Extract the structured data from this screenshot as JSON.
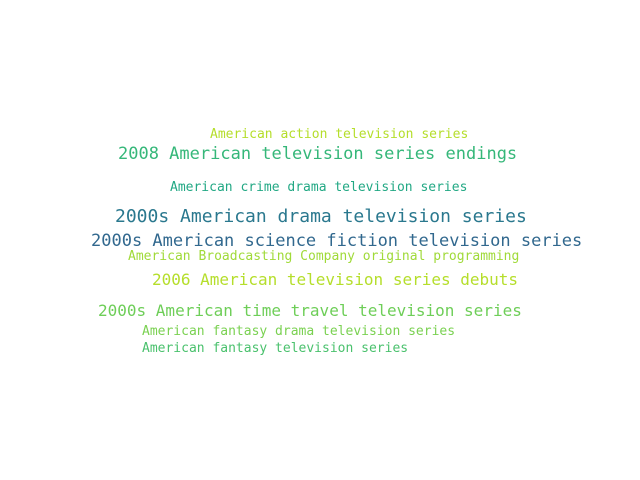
{
  "word_cloud": {
    "words": [
      {
        "text": "American action television series",
        "color": "#b5de2b"
      },
      {
        "text": "2008 American television series endings",
        "color": "#35b779"
      },
      {
        "text": "American crime drama television series",
        "color": "#22a884"
      },
      {
        "text": "2000s American drama television series",
        "color": "#2a788e"
      },
      {
        "text": "2000s American science fiction television series",
        "color": "#31688e"
      },
      {
        "text": "American Broadcasting Company original programming",
        "color": "#a0da39"
      },
      {
        "text": "2006 American television series debuts",
        "color": "#b5de2b"
      },
      {
        "text": "2000s American time travel television series",
        "color": "#6ece58"
      },
      {
        "text": "American fantasy drama television series",
        "color": "#7ad151"
      },
      {
        "text": "American fantasy television series",
        "color": "#4ac16d"
      }
    ]
  }
}
